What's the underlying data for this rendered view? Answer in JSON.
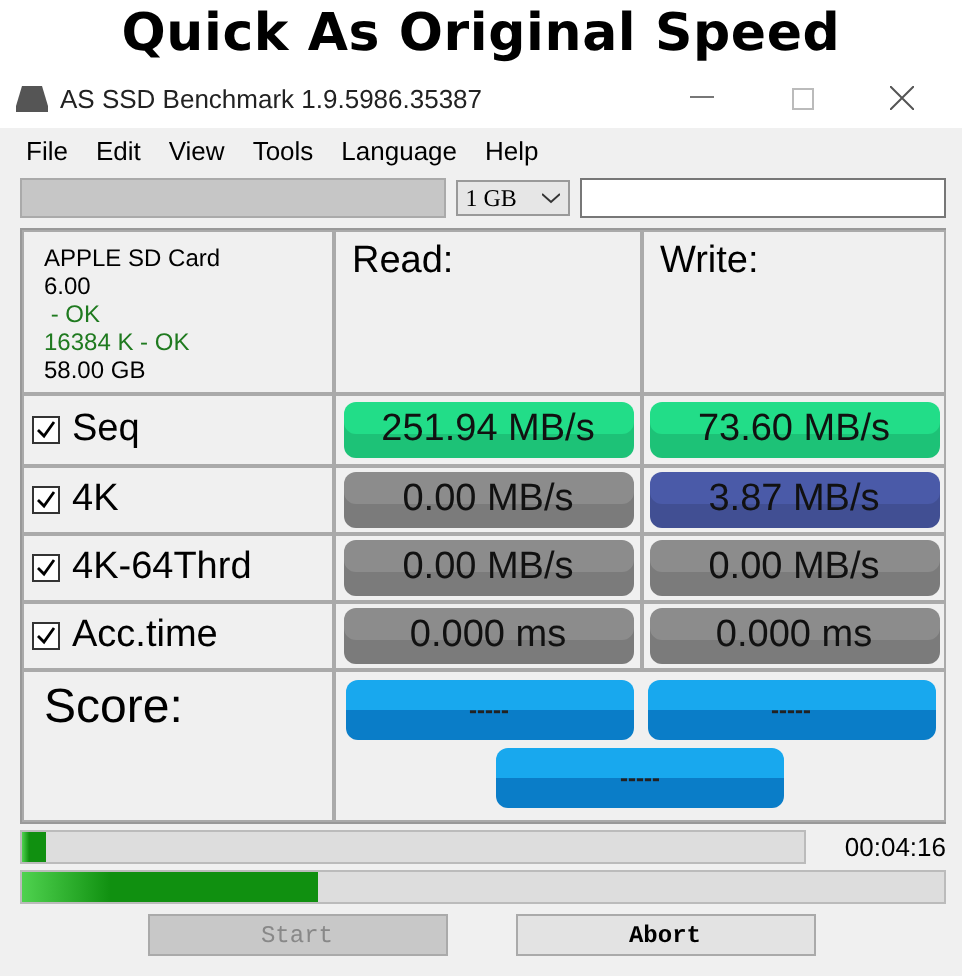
{
  "caption": "Quick As Original Speed",
  "window": {
    "title": "AS SSD Benchmark 1.9.5986.35387"
  },
  "menu": [
    "File",
    "Edit",
    "View",
    "Tools",
    "Language",
    "Help"
  ],
  "toolbar": {
    "size": "1 GB"
  },
  "device": {
    "lines": [
      {
        "text": "APPLE SD Card",
        "color": "#000000"
      },
      {
        "text": "6.00",
        "color": "#000000"
      },
      {
        "text": " - OK",
        "color": "#1f7a1f"
      },
      {
        "text": "16384 K - OK",
        "color": "#1f7a1f"
      },
      {
        "text": "58.00 GB",
        "color": "#000000"
      }
    ]
  },
  "headers": [
    "Read:",
    "Write:"
  ],
  "tests": [
    {
      "label": "Seq",
      "checked": true,
      "read": {
        "value": "251.94 MB/s",
        "color": "#22dd88"
      },
      "write": {
        "value": "73.60 MB/s",
        "color": "#22dd88"
      }
    },
    {
      "label": "4K",
      "checked": true,
      "read": {
        "value": "0.00 MB/s",
        "color": "#8c8c8c"
      },
      "write": {
        "value": "3.87 MB/s",
        "color": "#4a5aa8"
      }
    },
    {
      "label": "4K-64Thrd",
      "checked": true,
      "read": {
        "value": "0.00 MB/s",
        "color": "#8c8c8c"
      },
      "write": {
        "value": "0.00 MB/s",
        "color": "#8c8c8c"
      }
    },
    {
      "label": "Acc.time",
      "checked": true,
      "read": {
        "value": "0.000 ms",
        "color": "#8c8c8c"
      },
      "write": {
        "value": "0.000 ms",
        "color": "#8c8c8c"
      }
    }
  ],
  "score": {
    "label": "Score:",
    "read": "-----",
    "write": "-----",
    "total": "-----"
  },
  "progress": [
    {
      "level": 0.03,
      "time": "00:04:16"
    },
    {
      "level": 0.32
    }
  ],
  "buttons": [
    {
      "label": "Start",
      "disabled": true
    },
    {
      "label": "Abort",
      "disabled": false
    }
  ]
}
